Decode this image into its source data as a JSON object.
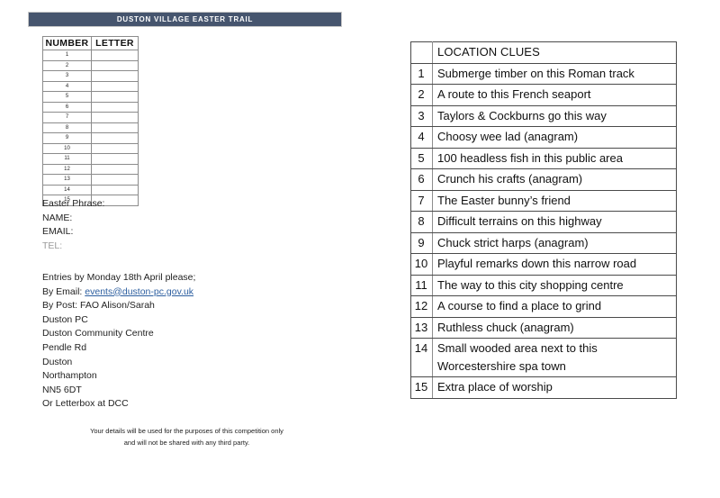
{
  "banner": {
    "title": "DUSTON VILLAGE EASTER TRAIL",
    "background_color": "#46556e",
    "text_color": "#ffffff"
  },
  "entry_table": {
    "headers": [
      "NUMBER",
      "LETTER"
    ],
    "rows": [
      {
        "number": "1",
        "letter": ""
      },
      {
        "number": "2",
        "letter": ""
      },
      {
        "number": "3",
        "letter": ""
      },
      {
        "number": "4",
        "letter": ""
      },
      {
        "number": "5",
        "letter": ""
      },
      {
        "number": "6",
        "letter": ""
      },
      {
        "number": "7",
        "letter": ""
      },
      {
        "number": "8",
        "letter": ""
      },
      {
        "number": "9",
        "letter": ""
      },
      {
        "number": "10",
        "letter": ""
      },
      {
        "number": "11",
        "letter": ""
      },
      {
        "number": "12",
        "letter": ""
      },
      {
        "number": "13",
        "letter": ""
      },
      {
        "number": "14",
        "letter": ""
      },
      {
        "number": "15",
        "letter": ""
      }
    ]
  },
  "form": {
    "fields": [
      {
        "label": "Easter Phrase:",
        "muted": false
      },
      {
        "label": "NAME:",
        "muted": false
      },
      {
        "label": "EMAIL:",
        "muted": false
      },
      {
        "label": "TEL:",
        "muted": true
      }
    ]
  },
  "entry_instructions": {
    "deadline": "Entries by Monday 18th April please;",
    "email_prefix": "By Email: ",
    "email_link": "events@duston-pc.gov.uk",
    "email_link_color": "#2d5fa0",
    "post_lines": [
      "By Post: FAO Alison/Sarah",
      "Duston PC",
      "Duston Community Centre",
      "Pendle Rd",
      "Duston",
      "Northampton",
      "NN5 6DT",
      "Or Letterbox at DCC"
    ]
  },
  "disclaimer": {
    "line1": "Your details will be used for the purposes of this competition only",
    "line2": "and will not be shared with any third party."
  },
  "clues_table": {
    "header_number": "",
    "header_title": "LOCATION CLUES",
    "clues": [
      {
        "number": "1",
        "text": "Submerge timber on this Roman track"
      },
      {
        "number": "2",
        "text": "A route to this French seaport"
      },
      {
        "number": "3",
        "text": "Taylors & Cockburns go this way"
      },
      {
        "number": "4",
        "text": "Choosy wee lad (anagram)"
      },
      {
        "number": "5",
        "text": "100 headless fish in this public area"
      },
      {
        "number": "6",
        "text": "Crunch his crafts (anagram)"
      },
      {
        "number": "7",
        "text": "The Easter bunny’s friend"
      },
      {
        "number": "8",
        "text": "Difficult terrains on this highway"
      },
      {
        "number": "9",
        "text": "Chuck strict harps (anagram)"
      },
      {
        "number": "10",
        "text": "Playful remarks down this narrow road"
      },
      {
        "number": "11",
        "text": "The way to this city shopping centre"
      },
      {
        "number": "12",
        "text": "A course to find a place to grind"
      },
      {
        "number": "13",
        "text": "Ruthless chuck (anagram)"
      },
      {
        "number": "14",
        "text": "Small wooded area next to this Worcestershire spa town"
      },
      {
        "number": "15",
        "text": "Extra place of worship"
      }
    ]
  }
}
